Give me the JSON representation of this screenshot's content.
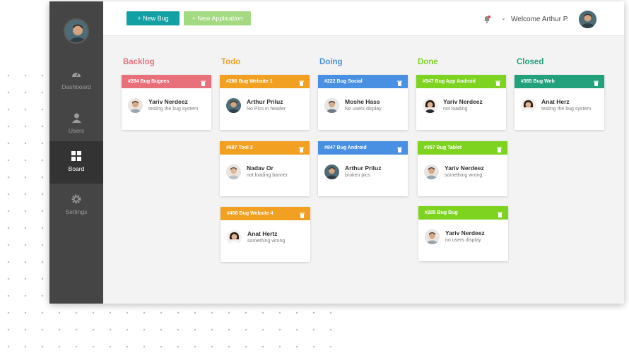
{
  "toolbar": {
    "new_bug_label": "+ New Bug",
    "new_application_label": "+ New Application",
    "welcome_text": "Welcome Arthur P."
  },
  "sidebar": {
    "items": [
      {
        "label": "Dashboard",
        "icon": "gauge-icon"
      },
      {
        "label": "Users",
        "icon": "user-icon"
      },
      {
        "label": "Board",
        "icon": "grid-icon",
        "active": true
      },
      {
        "label": "Settings",
        "icon": "gear-icon"
      }
    ]
  },
  "colors": {
    "backlog": "#e8707b",
    "todo": "#f1a021",
    "doing": "#4a90e2",
    "done": "#7ed321",
    "closed": "#23a07c",
    "sidebar": "#454545",
    "new_bug_button": "#13a0a4",
    "new_application_button": "#a3d980"
  },
  "board": {
    "columns": [
      {
        "title": "Backlog",
        "color": "#e8707b",
        "cards": [
          {
            "title": "#284 Bug Bugees",
            "name": "Yariv Nerdeez",
            "desc": "testing the bug system",
            "avatar": "man-light"
          }
        ]
      },
      {
        "title": "Todo",
        "color": "#f1a021",
        "cards": [
          {
            "title": "#286 Bug Website 1",
            "name": "Arthur Priluz",
            "desc": "No Pics in header",
            "avatar": "man-dark"
          },
          {
            "title": "#687 Tool 3",
            "name": "Nadav Or",
            "desc": "not loading banner",
            "avatar": "man-light"
          },
          {
            "title": "#458 Bug Website 4",
            "name": "Anat Hertz",
            "desc": "something wrong",
            "avatar": "woman"
          }
        ]
      },
      {
        "title": "Doing",
        "color": "#4a90e2",
        "cards": [
          {
            "title": "#222 Bug Social",
            "name": "Moshe Hass",
            "desc": "No users display",
            "avatar": "man-light"
          },
          {
            "title": "#847 Bug Android",
            "name": "Arthur Priluz",
            "desc": "broken pics",
            "avatar": "man-dark"
          }
        ]
      },
      {
        "title": "Done",
        "color": "#7ed321",
        "cards": [
          {
            "title": "#547 Bug App Android",
            "name": "Yariv Nerdeez",
            "desc": "not  loading",
            "avatar": "woman"
          },
          {
            "title": "#357 Bug Tablet",
            "name": "Yariv Nerdeez",
            "desc": "something wrong",
            "avatar": "man-light"
          },
          {
            "title": "#285 Bug Bug",
            "name": "Yariv Nerdeez",
            "desc": "no users display",
            "avatar": "man-light"
          }
        ]
      },
      {
        "title": "Closed",
        "color": "#23a07c",
        "cards": [
          {
            "title": "#365 Bug Web",
            "name": "Anat Herz",
            "desc": "testing the bug system",
            "avatar": "woman"
          }
        ]
      }
    ]
  }
}
